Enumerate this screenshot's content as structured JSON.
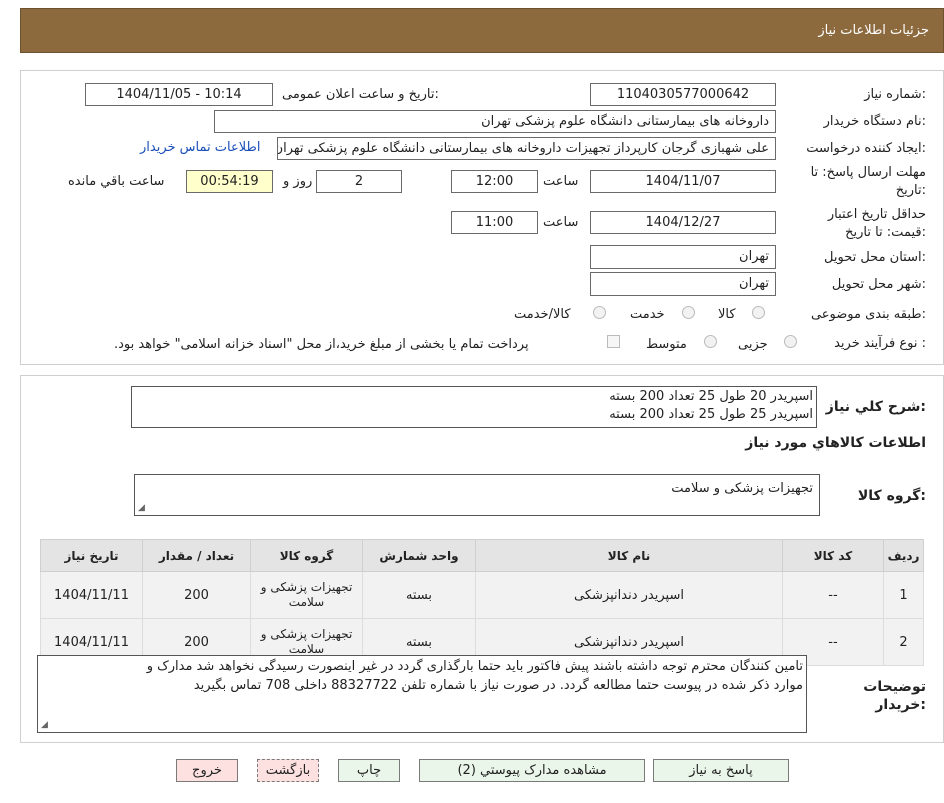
{
  "header": {
    "title": "جزئیات اطلاعات نیاز"
  },
  "need_number": {
    "label": "شماره نیاز:",
    "value": "1104030577000642"
  },
  "announce": {
    "label": "تاریخ و ساعت اعلان عمومی:",
    "value": "1404/11/05 - 10:14"
  },
  "buyer_org": {
    "label": "نام دستگاه خریدار:",
    "value": "داروخانه های بیمارستانی دانشگاه علوم پزشکی تهران"
  },
  "requester": {
    "label": "ایجاد کننده درخواست:",
    "value": "علی شهبازی گرجان کارپرداز تجهیزات داروخانه های بیمارستانی دانشگاه علوم پزشکی تهران",
    "contact_link": "اطلاعات تماس خریدار"
  },
  "deadline": {
    "label_line1": "مهلت ارسال پاسخ: تا",
    "label_line2": "تاریخ:",
    "date": "1404/11/07",
    "time_label": "ساعت",
    "time": "12:00",
    "days": "2",
    "days_label": "روز و",
    "remaining": "00:54:19",
    "remaining_label": "ساعت باقي مانده"
  },
  "validity": {
    "label_line1": "حداقل تاریخ اعتبار",
    "label_line2": "قیمت: تا تاریخ:",
    "date": "1404/12/27",
    "time_label": "ساعت",
    "time": "11:00"
  },
  "province": {
    "label": "استان محل تحویل:",
    "value": "تهران"
  },
  "city": {
    "label": "شهر محل تحویل:",
    "value": "تهران"
  },
  "category": {
    "label": "طبقه بندی موضوعی:",
    "options": [
      "کالا",
      "خدمت",
      "کالا/خدمت"
    ]
  },
  "process": {
    "label": "نوع فرآیند خرید :",
    "options": [
      "جزیی",
      "متوسط"
    ],
    "note": "پرداخت تمام یا بخشی از مبلغ خرید،از محل \"اسناد خزانه اسلامی\" خواهد بود."
  },
  "summary": {
    "label": "شرح کلي نياز:",
    "line1": "اسپریدر 20 طول 25 تعداد 200 بسته",
    "line2": "اسپریدر 25 طول 25 تعداد 200 بسته"
  },
  "goods_info": {
    "title": "اطلاعات کالاهاي مورد نياز"
  },
  "goods_group": {
    "label": "گروه کالا:",
    "value": "تجهیزات پزشکی و سلامت"
  },
  "table": {
    "headers": [
      "رديف",
      "کد کالا",
      "نام کالا",
      "واحد شمارش",
      "گروه کالا",
      "تعداد / مقدار",
      "تاریخ نیاز"
    ],
    "rows": [
      [
        "1",
        "--",
        "اسپریدر دندانپزشکی",
        "بسته",
        "تجهیزات پزشکی و سلامت",
        "200",
        "1404/11/11"
      ],
      [
        "2",
        "--",
        "اسپریدر دندانپزشکی",
        "بسته",
        "تجهیزات پزشکی و سلامت",
        "200",
        "1404/11/11"
      ]
    ]
  },
  "notes": {
    "label_line1": "توضیحات",
    "label_line2": "خریدار:",
    "line1": "تامین کنندگان محترم توجه داشته باشند پیش فاکتور باید حتما بارگذاری گردد در غیر اینصورت رسیدگی نخواهد شد مدارک و",
    "line2": "موارد ذکر شده در پیوست حتما مطالعه گردد. در صورت نیاز با شماره تلفن 88327722 داخلی 708 تماس بگیرید"
  },
  "buttons": {
    "reply": "پاسخ به نیاز",
    "attachments": "مشاهده مدارک پیوستي (2)",
    "print": "چاپ",
    "back": "بازگشت",
    "exit": "خروج"
  },
  "colors": {
    "header_bg": "#8c6a3e",
    "link": "#1a4fb8",
    "remaining_bg": "#ffffcc",
    "back_bg": "#fde0e0"
  }
}
